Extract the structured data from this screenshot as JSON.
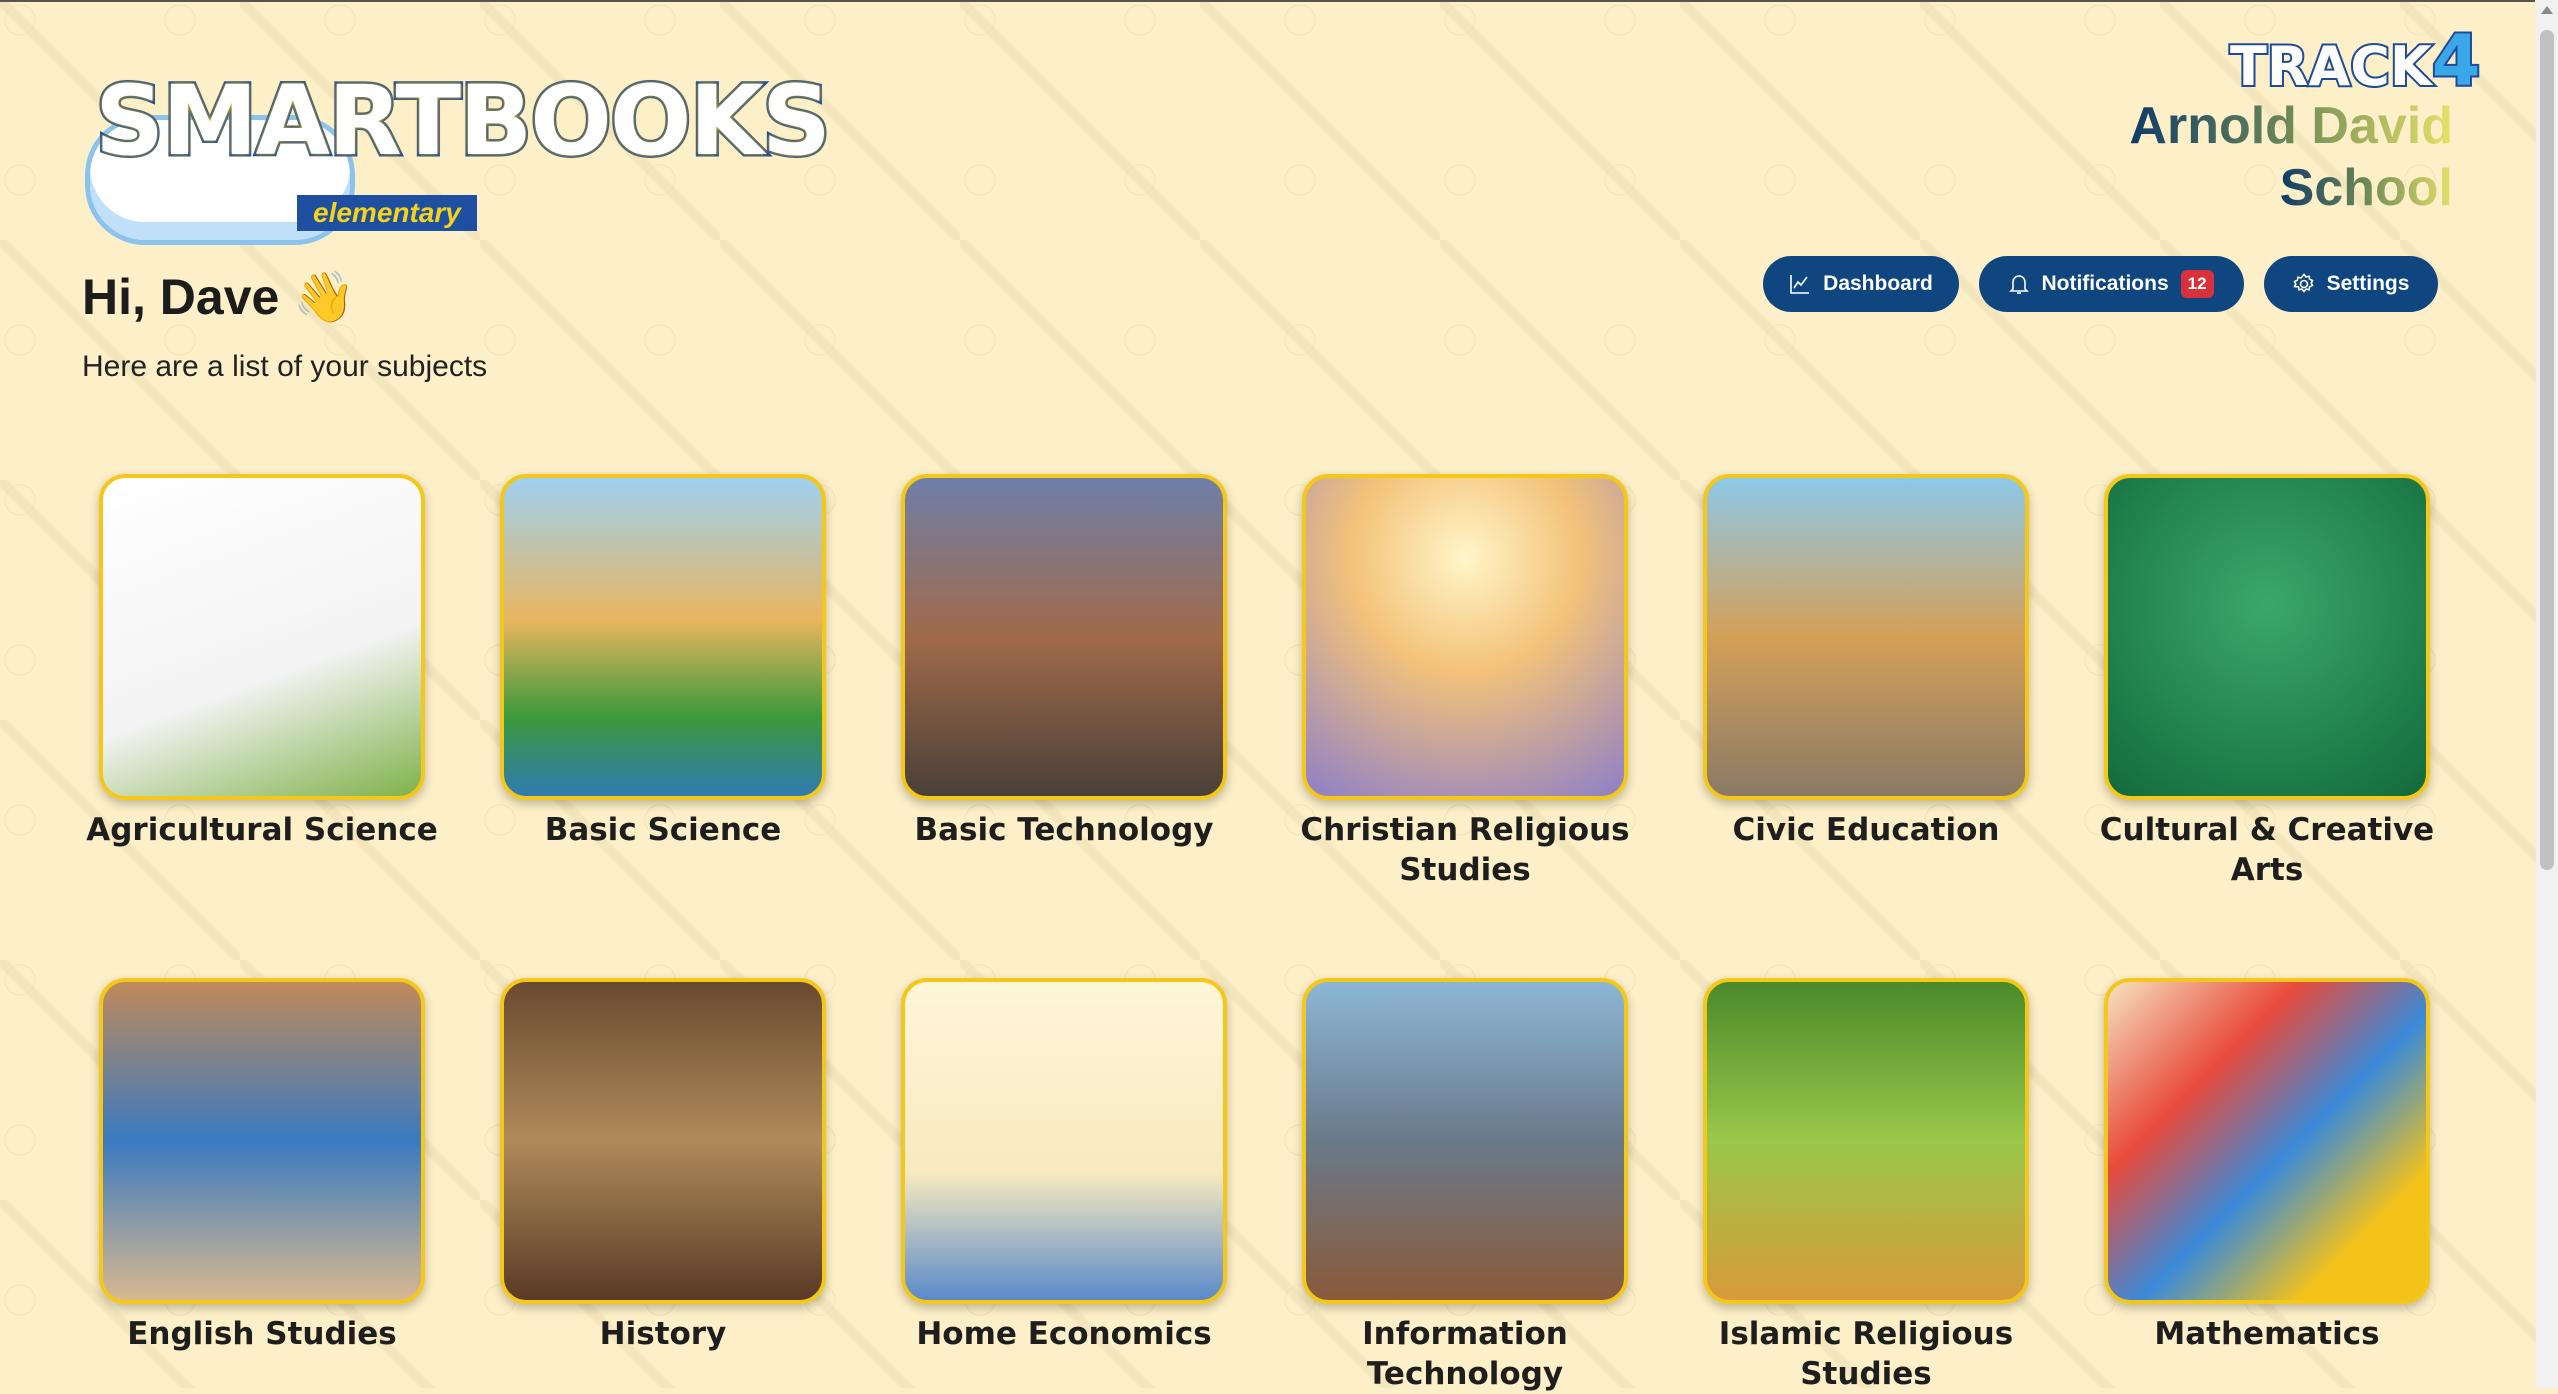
{
  "header": {
    "logo_text": "SMARTBOOKS",
    "logo_sub": "elementary",
    "track_label": "TRACK",
    "track_number": "4",
    "school_line1": "Arnold David",
    "school_line2": "School"
  },
  "greeting": {
    "title": "Hi, Dave",
    "emoji": "👋",
    "subtitle": "Here are a list of your subjects"
  },
  "nav": {
    "dashboard": "Dashboard",
    "notifications": "Notifications",
    "notifications_count": "12",
    "settings": "Settings"
  },
  "colors": {
    "primary": "#0f4680",
    "badge": "#d9303e",
    "card_border": "#f4c81a",
    "background": "#fdf0c8"
  },
  "subjects": [
    {
      "label": "Agricultural Science",
      "bg": "linear-gradient(160deg,#ffffff,#f3f3f3 60%,#7fb24a)"
    },
    {
      "label": "Basic Science",
      "bg": "linear-gradient(180deg,#9fd0f0,#e8b560 45%,#3c9a3a 75%,#2f7ab0)"
    },
    {
      "label": "Basic Technology",
      "bg": "linear-gradient(180deg,#6e7fa8,#a06a4a 50%,#4a4038)"
    },
    {
      "label": "Christian Religious Studies",
      "bg": "radial-gradient(circle at 50% 25%,#fff6c8,#f3c27a 40%,#8d7fc8 100%)"
    },
    {
      "label": "Civic Education",
      "bg": "linear-gradient(180deg,#8ec8e8,#d4a058 50%,#8a7a66)"
    },
    {
      "label": "Cultural & Creative Arts",
      "bg": "radial-gradient(circle at 50% 40%,#3aa86a,#136a3c)"
    },
    {
      "label": "English Studies",
      "bg": "linear-gradient(180deg,#c08a5a,#3a7ac0 50%,#d8b890)"
    },
    {
      "label": "History",
      "bg": "linear-gradient(180deg,#6a4a30,#b08a5a 50%,#5a3a26)"
    },
    {
      "label": "Home Economics",
      "bg": "linear-gradient(180deg,#fff6d8,#f8eac0 60%,#5a8ac8)"
    },
    {
      "label": "Information Technology",
      "bg": "linear-gradient(180deg,#8cb6d6,#6a7a8a 50%,#8a5a3a)"
    },
    {
      "label": "Islamic Religious Studies",
      "bg": "linear-gradient(180deg,#4a8a2a,#9ac84a 50%,#d89a3a)"
    },
    {
      "label": "Mathematics",
      "bg": "linear-gradient(135deg,#f6e2c0,#e84a3a 30%,#3a8ad8 55%,#f2c21a 80%)"
    }
  ]
}
